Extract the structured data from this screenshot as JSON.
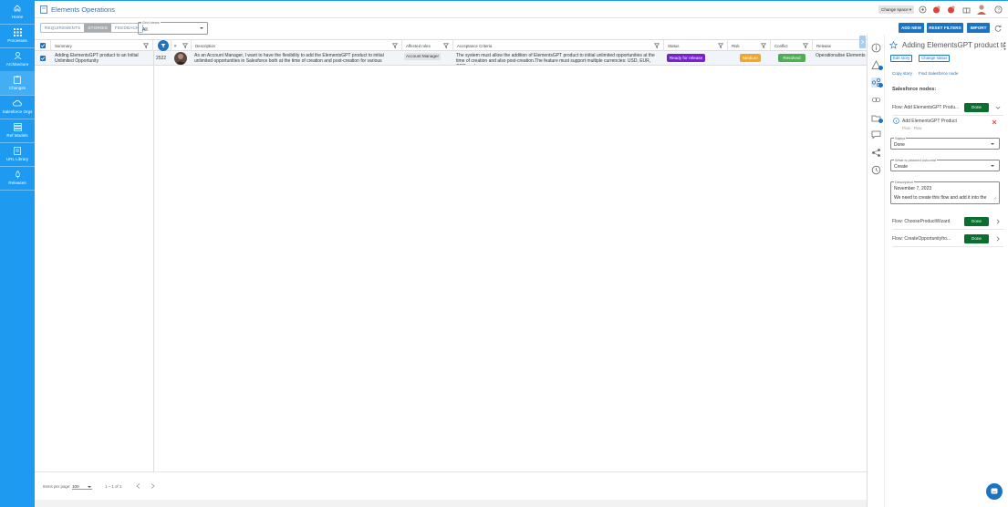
{
  "nav": {
    "items": [
      {
        "label": "Home",
        "icon": "home-icon"
      },
      {
        "label": "Processes",
        "icon": "grid-icon"
      },
      {
        "label": "Architecture",
        "icon": "architecture-icon"
      },
      {
        "label": "Changes",
        "icon": "clipboard-icon",
        "active": true
      },
      {
        "label": "Salesforce Orgs",
        "icon": "cloud-icon"
      },
      {
        "label": "Ref Models",
        "icon": "layers-icon"
      },
      {
        "label": "URL Library",
        "icon": "book-icon"
      },
      {
        "label": "Releases",
        "icon": "rocket-icon"
      }
    ]
  },
  "header": {
    "title": "Elements Operations",
    "change_space": "Change space"
  },
  "toolbar": {
    "tabs": [
      "REQUIREMENTS",
      "STORIES",
      "FEEDBACK"
    ],
    "active_tab": "STORIES",
    "grid_views_label": "Grid views",
    "grid_views_value": "All",
    "add_new": "ADD NEW",
    "reset_filters": "RESET FILTERS",
    "import": "IMPORT"
  },
  "grid": {
    "columns": [
      "Summary",
      "#",
      "Description",
      "Affected roles",
      "Acceptance Criteria",
      "Status",
      "Risk",
      "Conflict",
      "Release"
    ],
    "row": {
      "summary": "Adding ElementsGPT product to an Initial Unlimited Opportunity",
      "id": "2522",
      "description": "As an Account Manager, I want to have the flexibility to add the ElementsGPT product to initial unlimited opportunities in Salesforce both at the time of creation and post-creation for various",
      "role": "Account Manager",
      "criteria": "The system must allow the addition of ElementsGPT product to initial unlimited opportunities at the time of creation and also post-creation.The feature must support multiple currencies: USD, EUR, GBP, and",
      "status": "Ready for release",
      "risk": "Medium",
      "conflict": "Resolved",
      "release": "Operationalise Elements"
    },
    "footer": {
      "items_per_page_label": "Items per page:",
      "items_per_page": "100",
      "range": "1 – 1 of 1"
    }
  },
  "panel": {
    "title": "Adding ElementsGPT product to...",
    "edit_story": "Edit story",
    "change_status": "Change status",
    "copy_story": "Copy story",
    "find_node": "Find Salesforce node",
    "section_title": "Salesforce nodes:",
    "flows": [
      {
        "name": "Flow: Add ElementsGPT Produ...",
        "status": "Done"
      },
      {
        "name": "Flow: ChooseProductWizard",
        "status": "Done"
      },
      {
        "name": "Flow: CreateOpportunityfro...",
        "status": "Done"
      }
    ],
    "sub_node": {
      "name": "Add ElementsGPT Product",
      "type": "Flow - Flow"
    },
    "status_field": {
      "label": "Status",
      "value": "Done"
    },
    "outcome_field": {
      "label": "What is planned outcome",
      "value": "Create"
    },
    "description_field": {
      "label": "Description",
      "line1": "November 7, 2023",
      "line2": "We need to create this flow and add it into the"
    }
  },
  "colors": {
    "nav_bg": "#1e9bf0",
    "primary": "#1e73be",
    "status_purple": "#7b1fd6",
    "risk_orange": "#f5a623",
    "conflict_green": "#4caf50",
    "done_green": "#0a6e2e"
  }
}
